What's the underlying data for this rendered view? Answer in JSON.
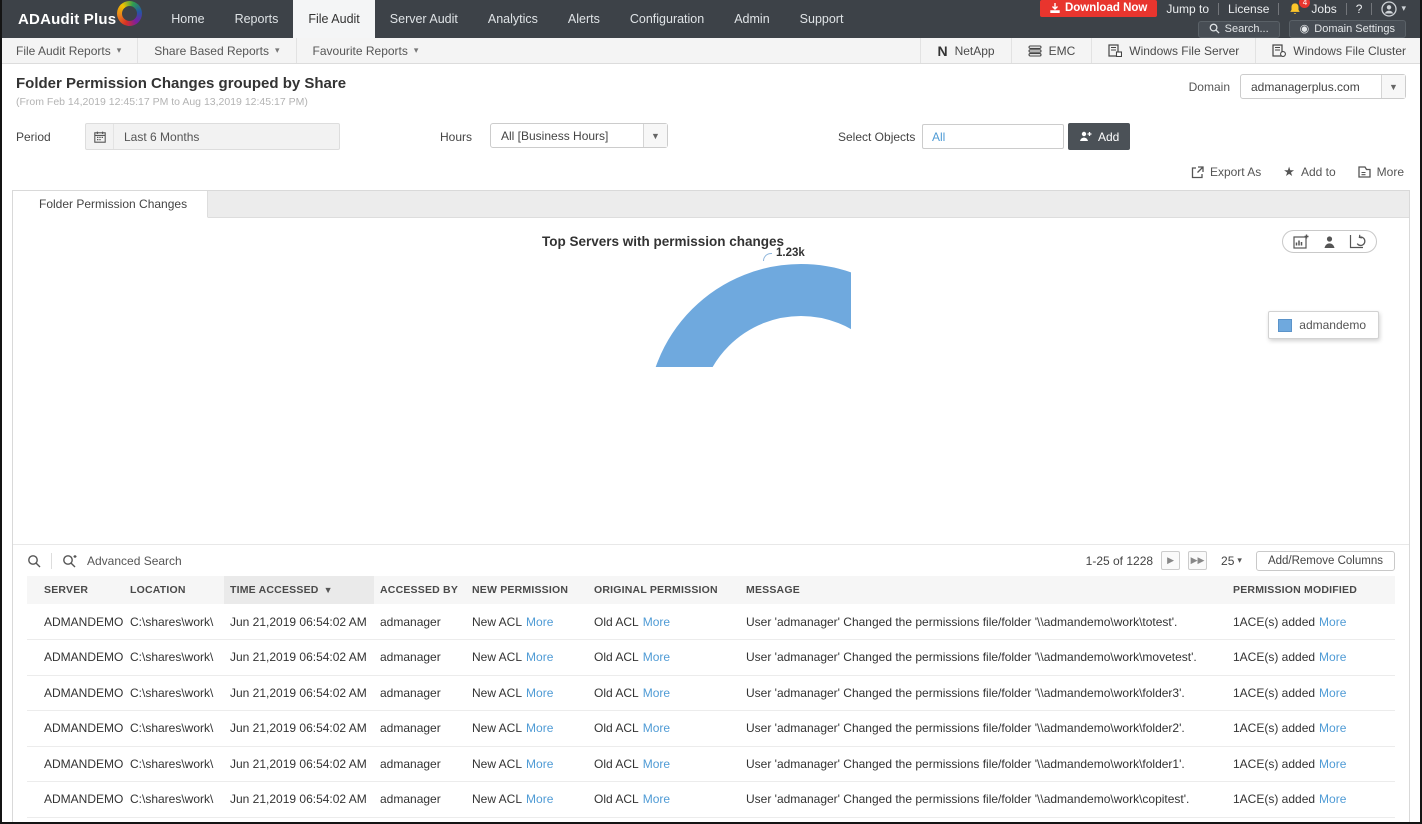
{
  "topnav": {
    "logo": "ADAudit Plus",
    "items": [
      "Home",
      "Reports",
      "File Audit",
      "Server Audit",
      "Analytics",
      "Alerts",
      "Configuration",
      "Admin",
      "Support"
    ],
    "active_item": "File Audit",
    "download_label": "Download Now",
    "jump_to": "Jump to",
    "license": "License",
    "notification_badge": "4",
    "jobs": "Jobs",
    "help": "?",
    "search_label": "Search...",
    "domain_settings_label": "Domain Settings"
  },
  "subnav": {
    "left_items": [
      "File Audit Reports",
      "Share Based Reports",
      "Favourite Reports"
    ],
    "right_items": [
      "NetApp",
      "EMC",
      "Windows File Server",
      "Windows File Cluster"
    ]
  },
  "header": {
    "title": "Folder Permission Changes grouped by Share",
    "subtitle": "(From Feb 14,2019 12:45:17 PM to Aug 13,2019 12:45:17 PM)",
    "domain_label": "Domain",
    "domain_value": "admanagerplus.com"
  },
  "filters": {
    "period_label": "Period",
    "period_value": "Last 6 Months",
    "hours_label": "Hours",
    "hours_value": "All [Business Hours]",
    "objects_label": "Select Objects",
    "objects_value": "All",
    "add_label": "Add"
  },
  "actions": {
    "export_as": "Export As",
    "add_to": "Add to",
    "more": "More"
  },
  "panel": {
    "tab_label": "Folder Permission Changes"
  },
  "chart_data": {
    "type": "pie",
    "variant": "semi-donut",
    "title": "Top Servers with permission changes",
    "series": [
      {
        "name": "admandemo",
        "value": 1230,
        "label": "1.23k"
      }
    ],
    "colors": [
      "#6fa9de"
    ],
    "legend_position": "right",
    "legend": [
      "admandemo"
    ],
    "point_label": "1.23k"
  },
  "table": {
    "advanced_search_label": "Advanced Search",
    "pagination": {
      "range": "1-25 of 1228",
      "page_size": "25",
      "add_remove_columns": "Add/Remove Columns"
    },
    "more_label": "More",
    "headers": [
      "SERVER",
      "LOCATION",
      "TIME ACCESSED",
      "ACCESSED BY",
      "NEW PERMISSION",
      "ORIGINAL PERMISSION",
      "MESSAGE",
      "PERMISSION MODIFIED"
    ],
    "sorted_column": "TIME ACCESSED",
    "rows": [
      {
        "server": "ADMANDEMO",
        "location": "C:\\shares\\work\\",
        "time_accessed": "Jun 21,2019 06:54:02 AM",
        "accessed_by": "admanager",
        "new_permission": "New ACL",
        "original_permission": "Old ACL",
        "message": "User 'admanager' Changed the permissions file/folder '\\\\admandemo\\work\\totest'.",
        "permission_modified": "1ACE(s) added"
      },
      {
        "server": "ADMANDEMO",
        "location": "C:\\shares\\work\\",
        "time_accessed": "Jun 21,2019 06:54:02 AM",
        "accessed_by": "admanager",
        "new_permission": "New ACL",
        "original_permission": "Old ACL",
        "message": "User 'admanager' Changed the permissions file/folder '\\\\admandemo\\work\\movetest'.",
        "permission_modified": "1ACE(s) added"
      },
      {
        "server": "ADMANDEMO",
        "location": "C:\\shares\\work\\",
        "time_accessed": "Jun 21,2019 06:54:02 AM",
        "accessed_by": "admanager",
        "new_permission": "New ACL",
        "original_permission": "Old ACL",
        "message": "User 'admanager' Changed the permissions file/folder '\\\\admandemo\\work\\folder3'.",
        "permission_modified": "1ACE(s) added"
      },
      {
        "server": "ADMANDEMO",
        "location": "C:\\shares\\work\\",
        "time_accessed": "Jun 21,2019 06:54:02 AM",
        "accessed_by": "admanager",
        "new_permission": "New ACL",
        "original_permission": "Old ACL",
        "message": "User 'admanager' Changed the permissions file/folder '\\\\admandemo\\work\\folder2'.",
        "permission_modified": "1ACE(s) added"
      },
      {
        "server": "ADMANDEMO",
        "location": "C:\\shares\\work\\",
        "time_accessed": "Jun 21,2019 06:54:02 AM",
        "accessed_by": "admanager",
        "new_permission": "New ACL",
        "original_permission": "Old ACL",
        "message": "User 'admanager' Changed the permissions file/folder '\\\\admandemo\\work\\folder1'.",
        "permission_modified": "1ACE(s) added"
      },
      {
        "server": "ADMANDEMO",
        "location": "C:\\shares\\work\\",
        "time_accessed": "Jun 21,2019 06:54:02 AM",
        "accessed_by": "admanager",
        "new_permission": "New ACL",
        "original_permission": "Old ACL",
        "message": "User 'admanager' Changed the permissions file/folder '\\\\admandemo\\work\\copitest'.",
        "permission_modified": "1ACE(s) added"
      }
    ]
  }
}
